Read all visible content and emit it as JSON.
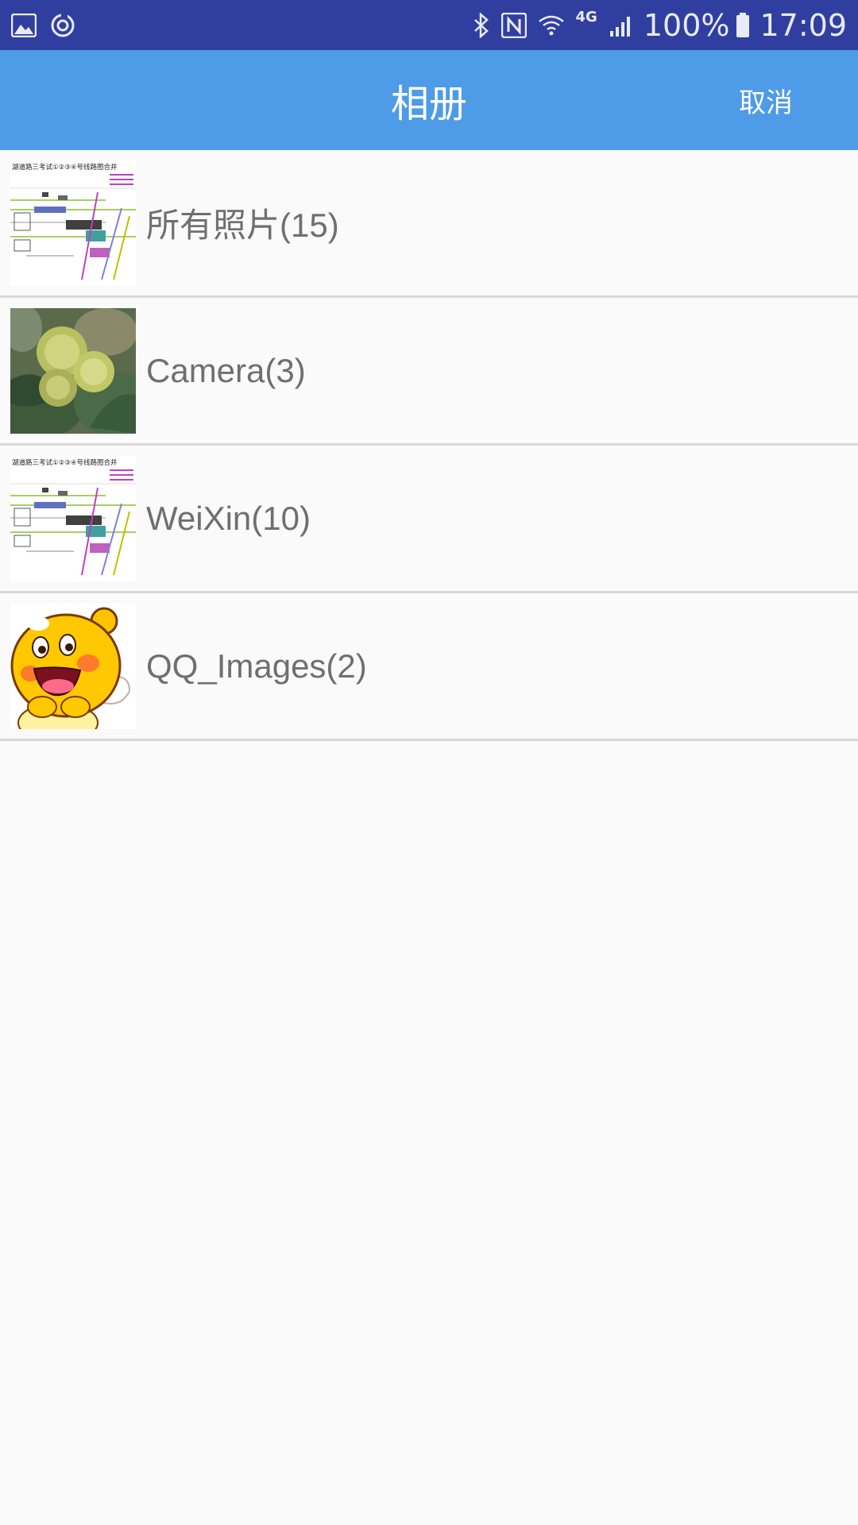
{
  "status_bar": {
    "battery": "100%",
    "time": "17:09",
    "network": "4G",
    "icons": [
      "image-icon",
      "sync-icon",
      "bluetooth-icon",
      "nfc-icon",
      "wifi-icon",
      "signal-icon",
      "battery-icon"
    ]
  },
  "toolbar": {
    "title": "相册",
    "cancel_label": "取消"
  },
  "albums": [
    {
      "name": "所有照片(15)",
      "thumbnail": "route-map-image"
    },
    {
      "name": "Camera(3)",
      "thumbnail": "chestnut-burs-photo"
    },
    {
      "name": "WeiXin(10)",
      "thumbnail": "route-map-image"
    },
    {
      "name": "QQ_Images(2)",
      "thumbnail": "qq-mascot-image"
    }
  ],
  "thumbnail_texts": {
    "route_map_header": "湖道路三考试①②③④号线路图合并"
  },
  "colors": {
    "status_bar": "#303f9f",
    "toolbar": "#4e9be8",
    "background": "#fafafa",
    "label_text": "#6f6f6f",
    "divider": "#d8d8d8"
  }
}
